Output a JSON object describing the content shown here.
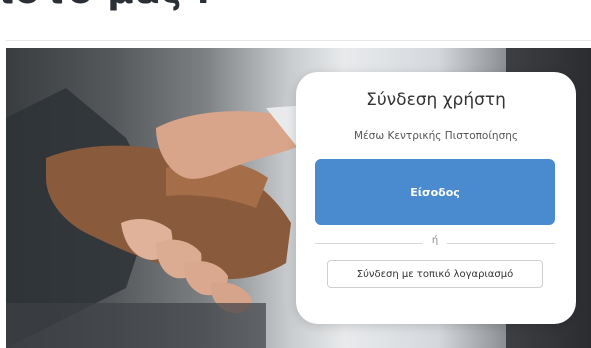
{
  "page": {
    "heading_fragment": "ιστο μας ."
  },
  "login_card": {
    "title": "Σύνδεση χρήστη",
    "subtitle": "Μέσω Κεντρικής Πιστοποίησης",
    "primary_button": "Είσοδος",
    "or_separator": "ή",
    "secondary_button": "Σύνδεση με τοπικό λογαριασμό"
  },
  "colors": {
    "primary": "#4a8bd0",
    "card_bg": "#ffffff"
  },
  "hero": {
    "image": "handshake-photo"
  }
}
